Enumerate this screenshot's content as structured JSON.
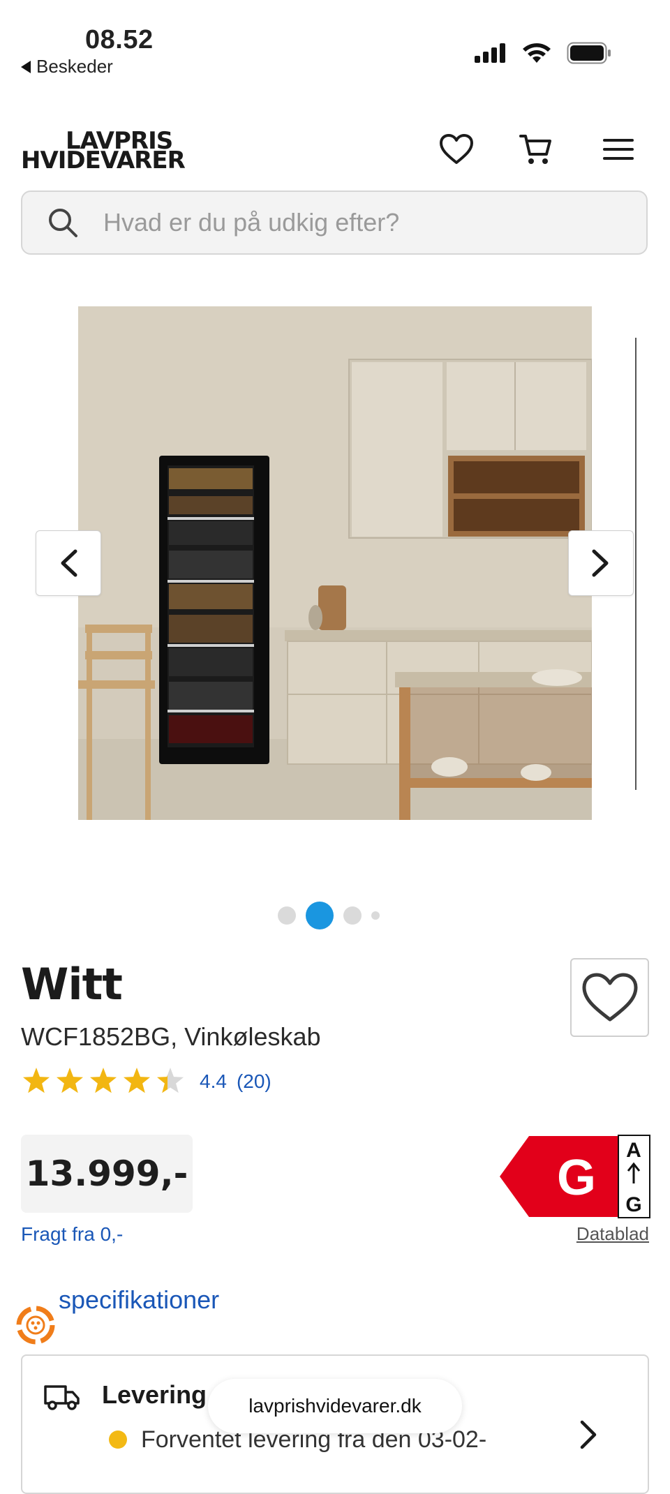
{
  "status_bar": {
    "time": "08.52",
    "back_label": "Beskeder"
  },
  "header": {
    "logo_line1": "LAVPRIS",
    "logo_line2": "HVIDEVARER",
    "icons": [
      "heart-icon",
      "cart-icon",
      "menu-icon"
    ]
  },
  "search": {
    "placeholder": "Hvad er du på udkig efter?"
  },
  "gallery": {
    "active_index": 1,
    "dot_count": 4,
    "accent_color": "#1a96e0"
  },
  "product": {
    "brand": "Witt",
    "model": "WCF1852BG, Vinkøleskab",
    "rating": 4.4,
    "rating_text": "4.4",
    "review_count": "(20)",
    "stars_max": 5,
    "price": "13.999,-",
    "freight": "Fragt fra 0,-",
    "energy_class": "G",
    "energy_scale_top": "A",
    "energy_scale_bottom": "G",
    "energy_color": "#e2001a",
    "datablad": "Datablad",
    "specs_link": "specifikationer"
  },
  "delivery": {
    "title": "Levering",
    "text": "Forventet levering fra den 03-02-",
    "status_color": "#f3b914"
  },
  "browser": {
    "url": "lavprishvidevarer.dk"
  }
}
